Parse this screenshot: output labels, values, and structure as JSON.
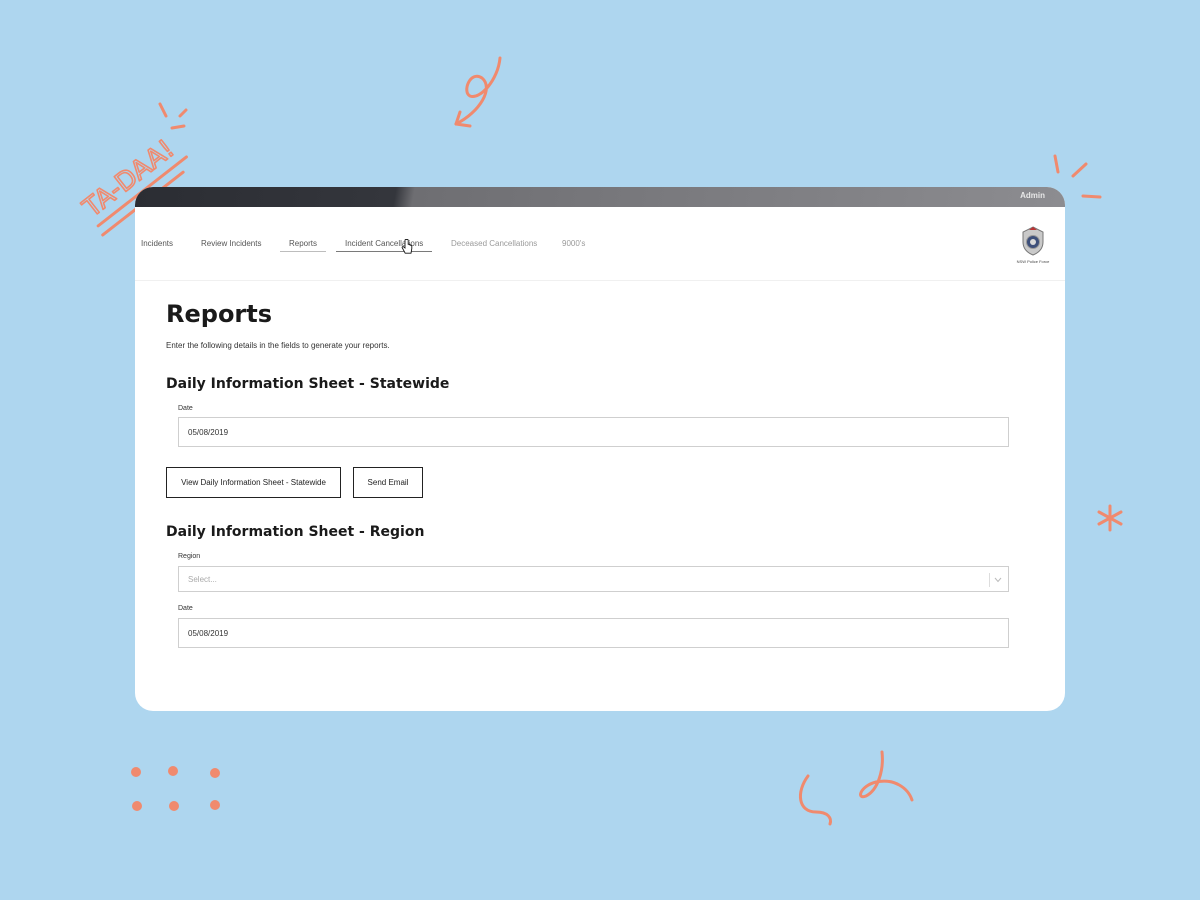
{
  "decoration": {
    "sticker_text": "TA-DAA!",
    "accent_color": "#f08a6e"
  },
  "topbar": {
    "user_label": "Admin"
  },
  "nav": {
    "items": [
      {
        "label": "Incidents"
      },
      {
        "label": "Review Incidents"
      },
      {
        "label": "Reports"
      },
      {
        "label": "Incident Cancellations"
      },
      {
        "label": "Deceased Cancellations"
      },
      {
        "label": "9000's"
      }
    ],
    "logo_text": "NSW Police Force"
  },
  "page": {
    "title": "Reports",
    "intro": "Enter the following details in the fields to generate your reports."
  },
  "statewide": {
    "title": "Daily Information Sheet - Statewide",
    "date_label": "Date",
    "date_value": "05/08/2019",
    "view_button": "View Daily Information Sheet - Statewide",
    "email_button": "Send Email"
  },
  "region": {
    "title": "Daily Information Sheet - Region",
    "region_label": "Region",
    "region_placeholder": "Select...",
    "date_label": "Date",
    "date_value": "05/08/2019"
  }
}
